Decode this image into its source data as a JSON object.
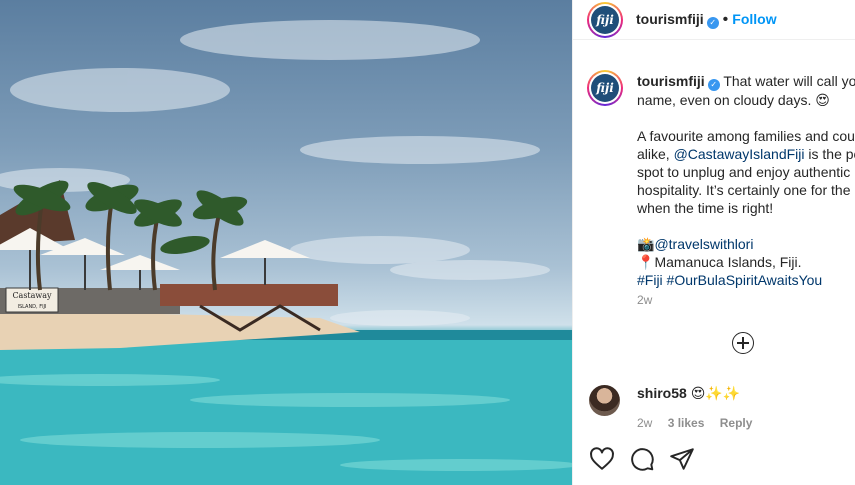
{
  "header": {
    "username": "tourismfiji",
    "verified_mark": "✓",
    "separator": "•",
    "follow_label": "Follow"
  },
  "avatar": {
    "logo_text": "fiji"
  },
  "photo": {
    "sign_line1": "Castaway",
    "sign_line2": "ISLAND, FIJI"
  },
  "caption": {
    "username": "tourismfiji",
    "line1": "That water will call you",
    "line2": "name, even on cloudy days. 😍",
    "para2_line1": "A favourite among families and coup",
    "para2_line2_pre": "alike, ",
    "para2_mention": "@CastawayIslandFiji",
    "para2_line2_post": " is the per",
    "para2_line3": "spot to unplug and enjoy authentic",
    "para2_line4": "hospitality. It’s certainly one for the",
    "para2_line5": "when the time is right!",
    "credit_icon": "📸",
    "credit_mention": "@travelswithlori",
    "location_icon": "📍",
    "location": "Mamanuca Islands, Fiji.",
    "hashtags": "#Fiji #OurBulaSpiritAwaitsYou"
  },
  "post_time": "2w",
  "comment": {
    "username": "shiro58",
    "text": "😍✨✨",
    "time": "2w",
    "likes": "3 likes",
    "reply": "Reply"
  },
  "icons": {
    "like": "heart-icon",
    "comment": "comment-icon",
    "share": "share-icon",
    "more_comments": "plus-circle-icon"
  },
  "colors": {
    "follow": "#0095f6",
    "verified": "#3897f0",
    "link": "#00376b",
    "muted": "#8e8e8e"
  }
}
